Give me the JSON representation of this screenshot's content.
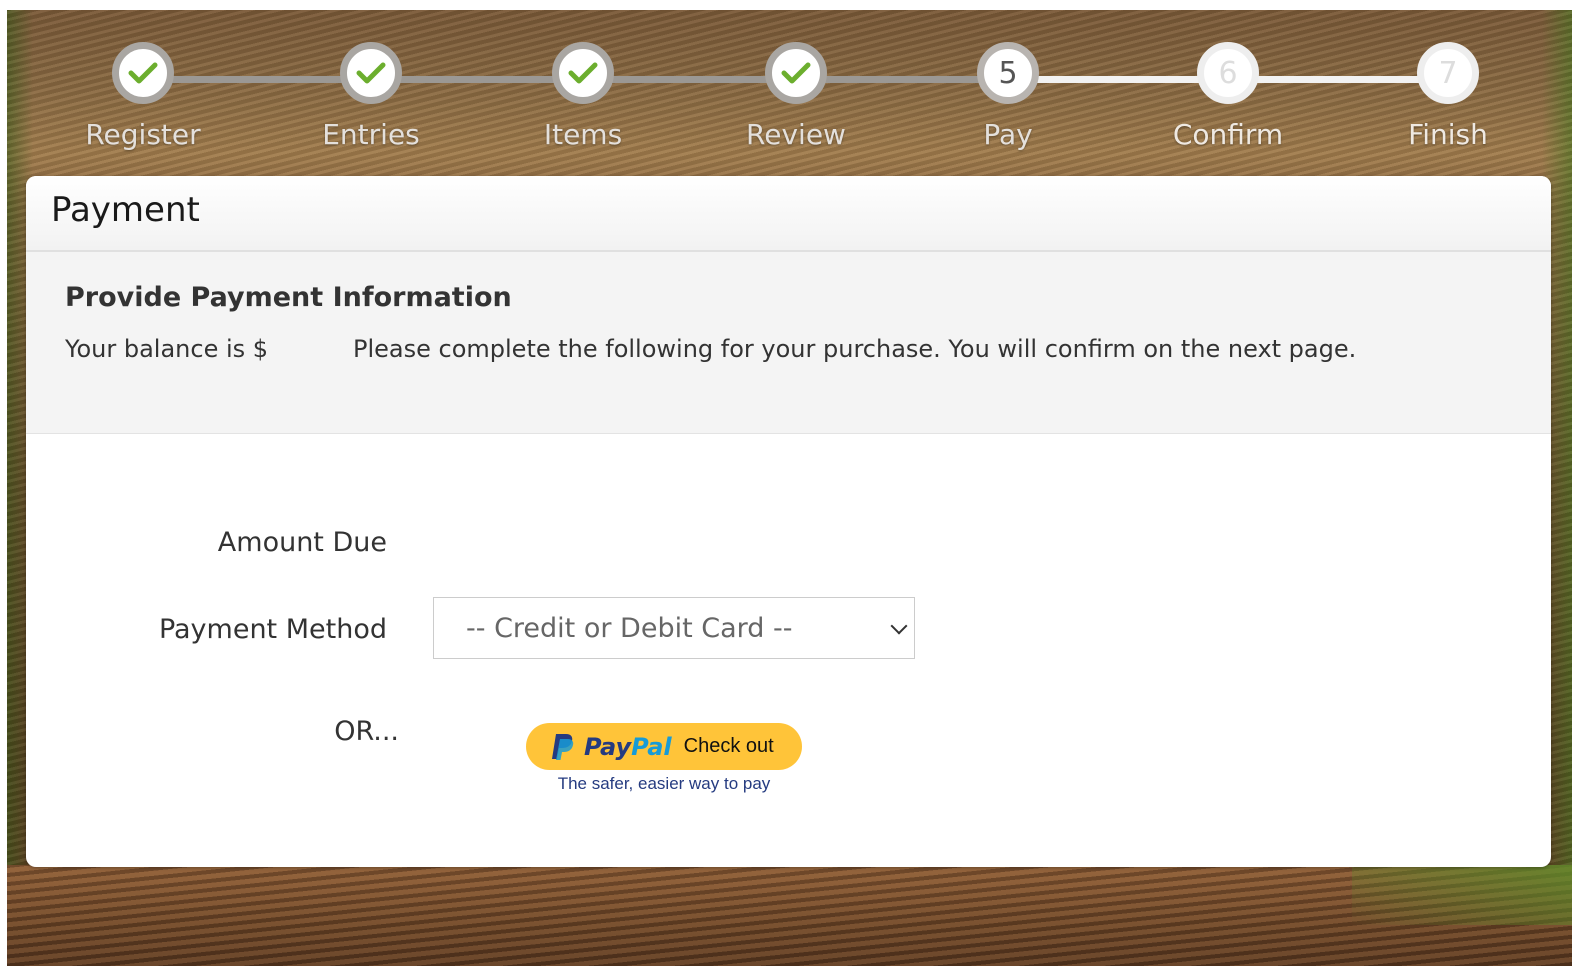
{
  "steps": [
    {
      "label": "Register",
      "number": "1",
      "state": "complete"
    },
    {
      "label": "Entries",
      "number": "2",
      "state": "complete"
    },
    {
      "label": "Items",
      "number": "3",
      "state": "complete"
    },
    {
      "label": "Review",
      "number": "4",
      "state": "complete"
    },
    {
      "label": "Pay",
      "number": "5",
      "state": "current"
    },
    {
      "label": "Confirm",
      "number": "6",
      "state": "upcoming"
    },
    {
      "label": "Finish",
      "number": "7",
      "state": "upcoming"
    }
  ],
  "card": {
    "title": "Payment",
    "heading": "Provide Payment Information",
    "balance_text": "Your balance is $",
    "instructions": "Please complete the following for your purchase. You will confirm on the next page."
  },
  "form": {
    "amount_due_label": "Amount Due",
    "amount_due_value": "",
    "payment_method_label": "Payment Method",
    "payment_method_selected": "-- Credit or Debit Card --",
    "or_label": "OR..."
  },
  "paypal": {
    "brand_pay": "Pay",
    "brand_pal": "Pal",
    "button_text": "Check out",
    "tagline": "The safer, easier way to pay"
  },
  "colors": {
    "paypal_yellow": "#ffc439",
    "paypal_dark_blue": "#253b80",
    "paypal_light_blue": "#179bd7",
    "check_green": "#6cae2e"
  }
}
